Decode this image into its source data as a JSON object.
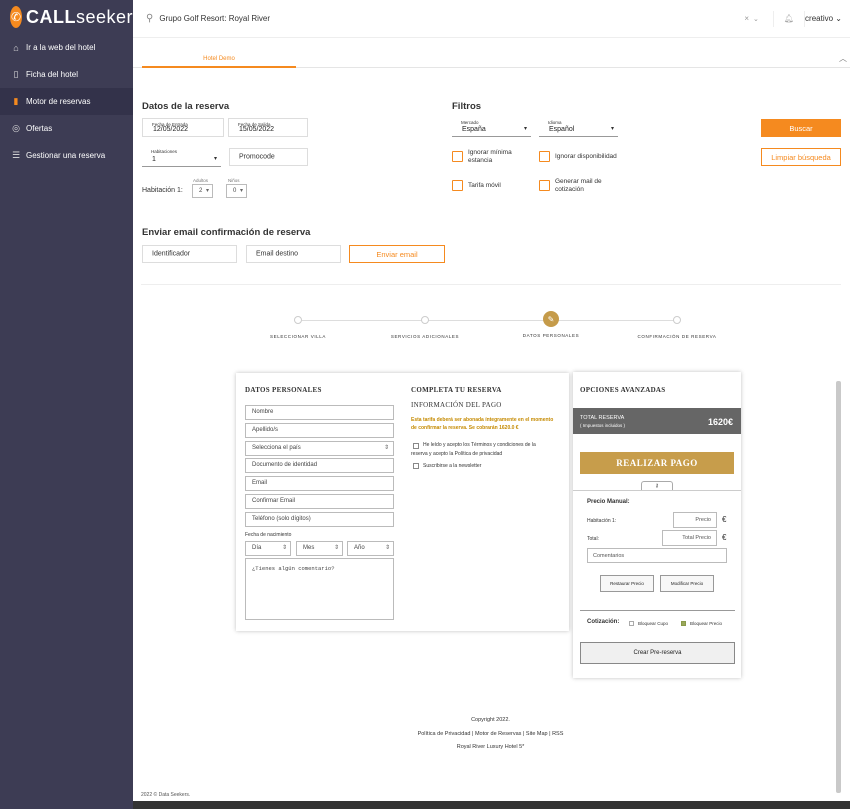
{
  "logo": {
    "brand_a": "CALL",
    "brand_b": "seeker"
  },
  "sidebar": {
    "items": [
      {
        "label": "Ir a la web del hotel"
      },
      {
        "label": "Ficha del hotel"
      },
      {
        "label": "Motor de reservas"
      },
      {
        "label": "Ofertas"
      },
      {
        "label": "Gestionar una reserva"
      }
    ]
  },
  "topbar": {
    "search": "Grupo Golf Resort: Royal River",
    "user": "creativo"
  },
  "tab": {
    "label": "Hotel Demo"
  },
  "booking": {
    "title": "Datos de la reserva",
    "checkin_label": "Fecha de Entrada",
    "checkin": "12/05/2022",
    "checkout_label": "Fecha de Salida",
    "checkout": "15/05/2022",
    "rooms_label": "Habitaciones",
    "rooms": "1",
    "promo": "Promocode",
    "room_label": "Habitación 1:",
    "adults_label": "Adultos",
    "adults": "2",
    "kids_label": "Niños",
    "kids": "0"
  },
  "filters": {
    "title": "Filtros",
    "market_label": "Mercado",
    "market": "España",
    "lang_label": "Idioma",
    "lang": "Español",
    "checks": [
      "Ignorar mínima estancia",
      "Ignorar disponibilidad",
      "Tarifa móvil",
      "Generar mail de cotización"
    ],
    "search_btn": "Buscar",
    "clear_btn": "Limpiar búsqueda"
  },
  "email": {
    "title": "Enviar email confirmación de reserva",
    "identifier": "Identificador",
    "dest": "Email destino",
    "send": "Enviar email"
  },
  "steps": [
    "SELECCIONAR VILLA",
    "SERVICIOS ADICIONALES",
    "DATOS PERSONALES",
    "CONFIRMACIÓN DE RESERVA"
  ],
  "personal": {
    "title": "DATOS PERSONALES",
    "fields": [
      "Nombre",
      "Apellido/s",
      "Selecciona el país",
      "Documento de identidad",
      "Email",
      "Confirmar Email",
      "Teléfono (solo dígitos)"
    ],
    "birth_label": "Fecha de nacimiento",
    "day": "Día",
    "month": "Mes",
    "year": "Año",
    "comment": "¿Tienes algún comentario?"
  },
  "complete": {
    "title": "COMPLETA TU RESERVA",
    "payinfo": "INFORMACIÓN DEL PAGO",
    "notice1": "Esta tarifa deberá ser abonada íntegramente en el momento",
    "notice2": "de confirmar la reserva. Se cobrarán 1620.0 €",
    "terms1": "He leído y acepto los Términos y condiciones de la",
    "terms2": "reserva y acepto la Política de privacidad",
    "newsletter": "Suscribirse a la newsletter"
  },
  "advanced": {
    "title": "OPCIONES AVANZADAS",
    "total_label": "TOTAL RESERVA",
    "taxes": "( Impuestos incluidos )",
    "total": "1620€",
    "pay": "REALIZAR PAGO",
    "manual": "Precio Manual:",
    "room1": "Habitación 1:",
    "price_ph": "Precio",
    "euro": "€",
    "total_row": "Total:",
    "total_ph": "Total Precio",
    "comments": "Comentarios",
    "restore": "Restaurar Precio",
    "modify": "Modificar Precio",
    "quote": "Cotización:",
    "block_quota": "Bloquear Cupo",
    "block_price": "Bloquear Precio",
    "create": "Crear Pre-reserva"
  },
  "footer": {
    "copy": "Copyright 2022.",
    "links": "Política de Privacidad | Motor de Reservas | Site Map | RSS",
    "hotel": "Royal River Luxury Hotel 5*",
    "bottom": "2022 © Data Seekers."
  }
}
